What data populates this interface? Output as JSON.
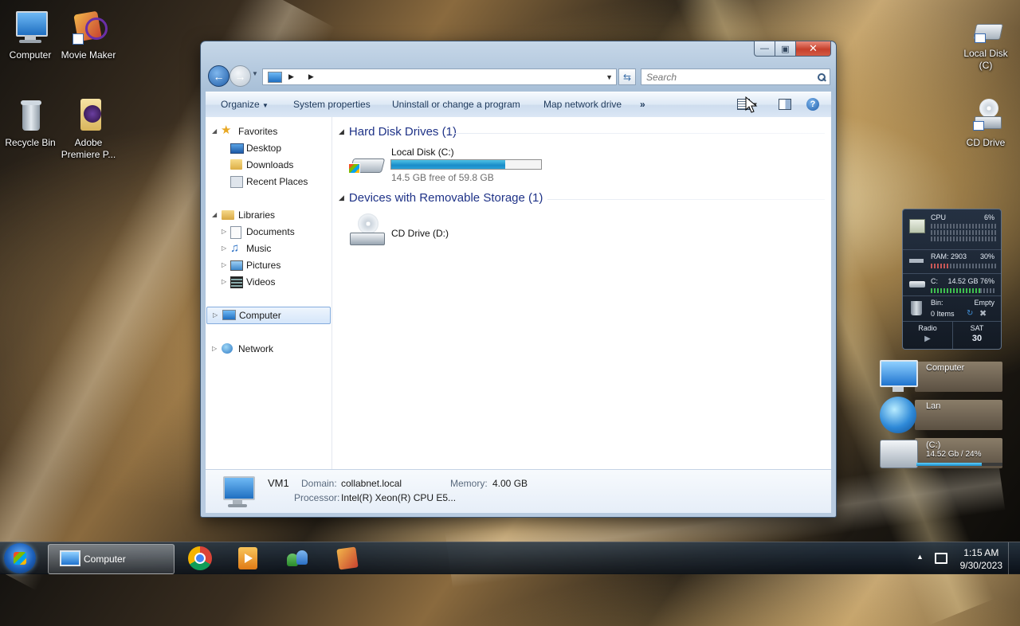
{
  "desktop": {
    "icons": {
      "computer": "Computer",
      "movie_maker": "Movie Maker",
      "recycle_bin": "Recycle Bin",
      "premiere_line1": "Adobe",
      "premiere_line2": "Premiere P...",
      "local_disk_line1": "Local Disk",
      "local_disk_line2": "(C)",
      "cd_drive": "CD Drive"
    }
  },
  "window": {
    "search_placeholder": "Search",
    "toolbar": {
      "organize": "Organize",
      "system_properties": "System properties",
      "uninstall": "Uninstall or change a program",
      "map_drive": "Map network drive",
      "more": "»"
    },
    "nav": {
      "favorites": "Favorites",
      "desktop": "Desktop",
      "downloads": "Downloads",
      "recent": "Recent Places",
      "libraries": "Libraries",
      "documents": "Documents",
      "music": "Music",
      "pictures": "Pictures",
      "videos": "Videos",
      "computer": "Computer",
      "network": "Network"
    },
    "groups": {
      "hdd": "Hard Disk Drives (1)",
      "removable": "Devices with Removable Storage (1)"
    },
    "drives": {
      "local_name": "Local Disk (C:)",
      "local_free": "14.5 GB free of 59.8 GB",
      "local_used_fraction": 0.76,
      "cd_name": "CD Drive (D:)"
    },
    "details": {
      "name": "VM1",
      "domain_label": "Domain:",
      "domain": "collabnet.local",
      "memory_label": "Memory:",
      "memory": "4.00 GB",
      "processor_label": "Processor:",
      "processor": "Intel(R) Xeon(R) CPU E5..."
    }
  },
  "gadget": {
    "cpu_label": "CPU",
    "cpu_value": "6%",
    "ram_label": "RAM: 2903",
    "ram_value": "30%",
    "c_label": "C:",
    "c_value": "14.52 GB 76%",
    "bin_label": "Bin:",
    "bin_value": "Empty",
    "bin_items": "0 Items",
    "radio": "Radio",
    "day": "SAT",
    "date": "30"
  },
  "side_gadgets": {
    "computer": "Computer",
    "lan": "Lan",
    "c_label": "(C:)",
    "c_value": "14.52 Gb / 24%",
    "c_fraction": 0.76
  },
  "taskbar": {
    "active_item": "Computer",
    "time": "1:15 AM",
    "date": "9/30/2023"
  }
}
